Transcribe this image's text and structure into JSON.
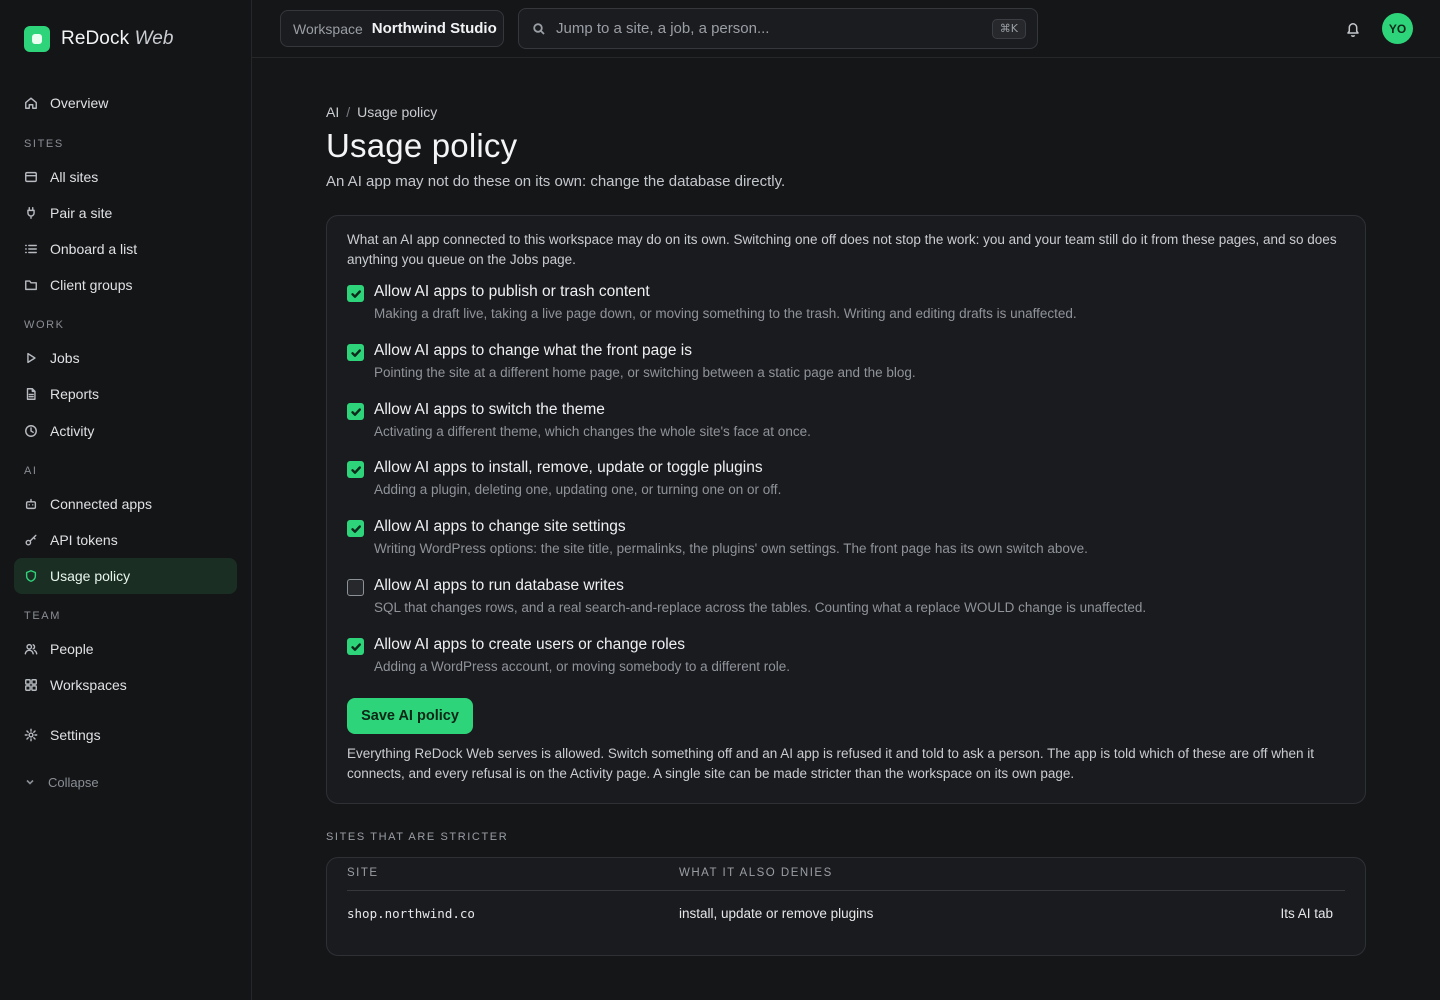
{
  "brand": {
    "name": "ReDock",
    "suffix": "Web"
  },
  "sidebar": {
    "overview": "Overview",
    "sections": {
      "sites": "SITES",
      "work": "WORK",
      "ai": "AI",
      "team": "TEAM"
    },
    "items": {
      "all_sites": "All sites",
      "pair_site": "Pair a site",
      "onboard_list": "Onboard a list",
      "client_groups": "Client groups",
      "jobs": "Jobs",
      "reports": "Reports",
      "activity": "Activity",
      "connected_apps": "Connected apps",
      "api_tokens": "API tokens",
      "usage_policy": "Usage policy",
      "people": "People",
      "workspaces": "Workspaces",
      "settings": "Settings"
    },
    "active": "usage_policy",
    "collapse": "Collapse"
  },
  "topbar": {
    "workspace_label": "Workspace",
    "workspace_value": "Northwind Studio",
    "search_placeholder": "Jump to a site, a job, a person...",
    "shortcut": "⌘K",
    "avatar_initials": "YO"
  },
  "breadcrumb": {
    "parent": "AI",
    "current": "Usage policy"
  },
  "page": {
    "title": "Usage policy",
    "subtitle": "An AI app may not do these on its own: change the database directly."
  },
  "policy": {
    "intro": "What an AI app connected to this workspace may do on its own. Switching one off does not stop the work: you and your team still do it from these pages, and so does anything you queue on the Jobs page.",
    "options": [
      {
        "title": "Allow AI apps to publish or trash content",
        "desc": "Making a draft live, taking a live page down, or moving something to the trash. Writing and editing drafts is unaffected.",
        "checked": true
      },
      {
        "title": "Allow AI apps to change what the front page is",
        "desc": "Pointing the site at a different home page, or switching between a static page and the blog.",
        "checked": true
      },
      {
        "title": "Allow AI apps to switch the theme",
        "desc": "Activating a different theme, which changes the whole site's face at once.",
        "checked": true
      },
      {
        "title": "Allow AI apps to install, remove, update or toggle plugins",
        "desc": "Adding a plugin, deleting one, updating one, or turning one on or off.",
        "checked": true
      },
      {
        "title": "Allow AI apps to change site settings",
        "desc": "Writing WordPress options: the site title, permalinks, the plugins' own settings. The front page has its own switch above.",
        "checked": true
      },
      {
        "title": "Allow AI apps to run database writes",
        "desc": "SQL that changes rows, and a real search-and-replace across the tables. Counting what a replace WOULD change is unaffected.",
        "checked": false
      },
      {
        "title": "Allow AI apps to create users or change roles",
        "desc": "Adding a WordPress account, or moving somebody to a different role.",
        "checked": true
      }
    ],
    "save_label": "Save AI policy",
    "footnote": "Everything ReDock Web serves is allowed. Switch something off and an AI app is refused it and told to ask a person. The app is told which of these are off when it connects, and every refusal is on the Activity page. A single site can be made stricter than the workspace on its own page."
  },
  "stricter": {
    "label": "SITES THAT ARE STRICTER",
    "columns": [
      "SITE",
      "WHAT IT ALSO DENIES"
    ],
    "rows": [
      {
        "site": "shop.northwind.co",
        "denies": "install, update or remove plugins",
        "link": "Its AI tab"
      }
    ]
  },
  "colors": {
    "accent": "#2ed47a",
    "background": "#151618",
    "card": "#1a1b1e"
  }
}
